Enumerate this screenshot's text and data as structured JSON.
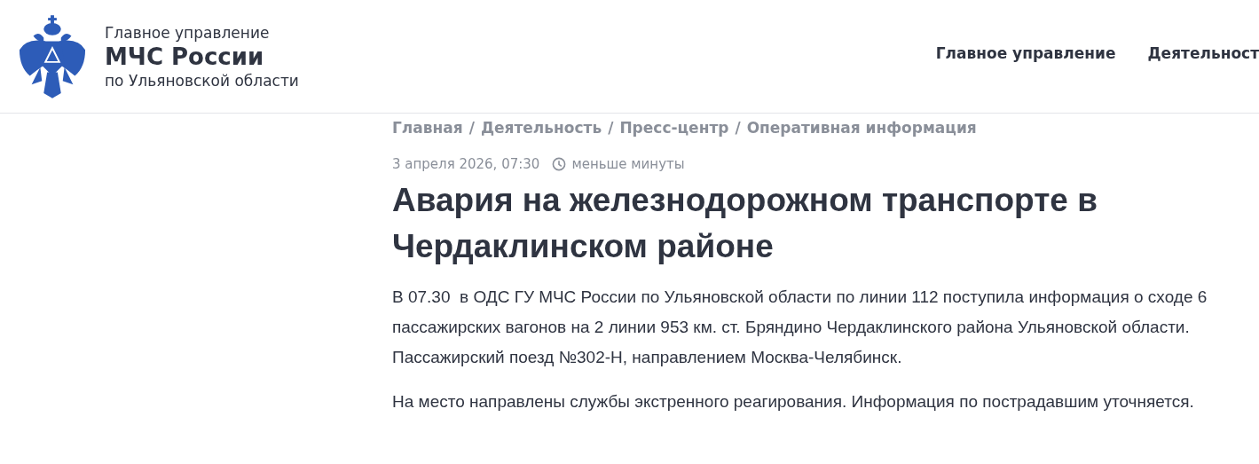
{
  "header": {
    "org_line1": "Главное управление",
    "org_name": "МЧС России",
    "org_line3": "по Ульяновской области",
    "nav": [
      {
        "label": "Главное управление"
      },
      {
        "label": "Деятельност"
      }
    ]
  },
  "breadcrumb": [
    {
      "label": "Главная",
      "sep": "/"
    },
    {
      "label": "Деятельность",
      "sep": "/"
    },
    {
      "label": "Пресс-центр",
      "sep": "/"
    },
    {
      "label": "Оперативная информация"
    }
  ],
  "article": {
    "date": "3 апреля 2026, 07:30",
    "read_time": "меньше минуты",
    "title": "Авария на железнодорожном транспорте в Чердаклинском районе",
    "paragraphs": [
      "В 07.30  в ОДС ГУ МЧС России по Ульяновской области по линии 112 поступила информация о сходе 6 пассажирских вагонов на 2 линии 953 км. ст. Бряндино Чердаклинского района Ульяновской области. Пассажирский поезд №302-Н, направлением Москва-Челябинск.",
      "На место направлены службы экстренного реагирования. Информация по пострадавшим уточняется."
    ]
  }
}
